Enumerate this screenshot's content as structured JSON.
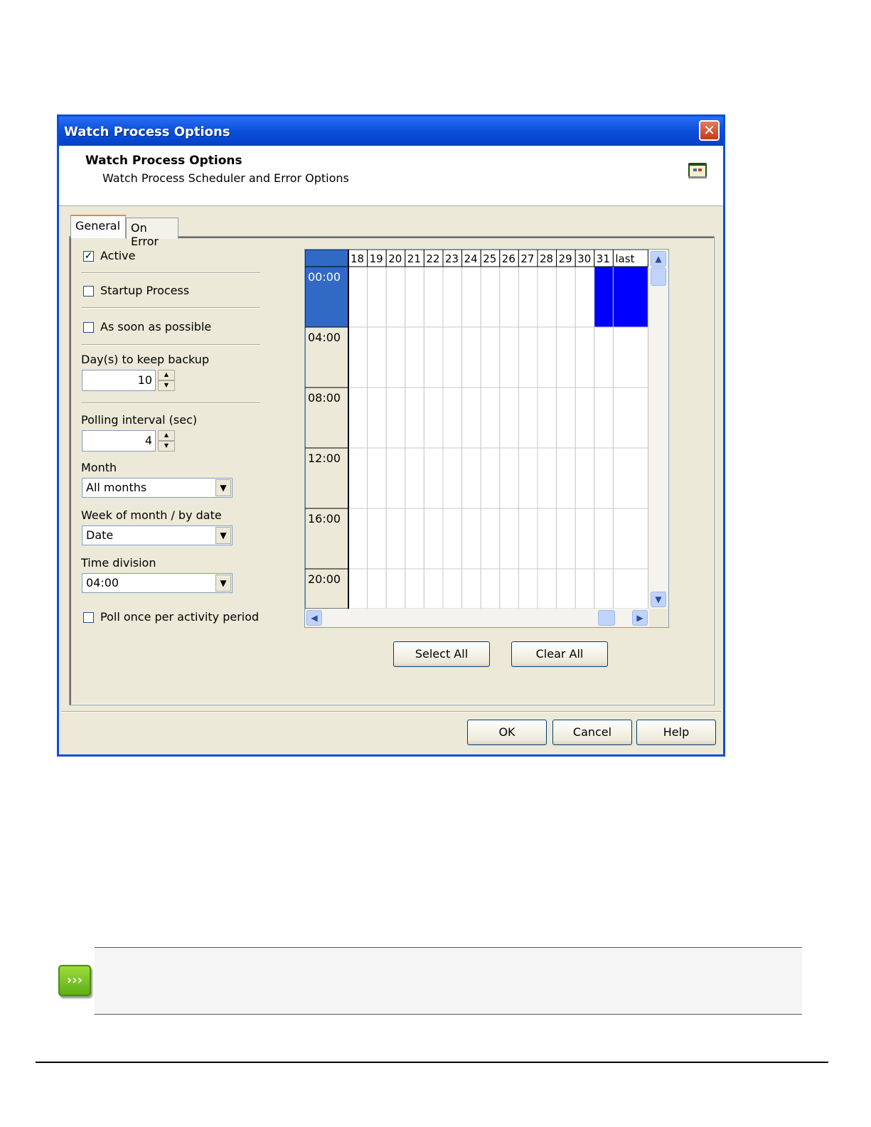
{
  "dialog": {
    "title": "Watch Process Options",
    "close_label": "✕",
    "header_title": "Watch Process Options",
    "header_subtitle": "Watch Process Scheduler and Error Options"
  },
  "tabs": [
    {
      "label": "General",
      "selected": true
    },
    {
      "label": "On Error",
      "selected": false
    }
  ],
  "general": {
    "active": {
      "label": "Active",
      "checked": true
    },
    "startup_process": {
      "label": "Startup Process",
      "checked": false
    },
    "as_soon_as_possible": {
      "label": "As soon as possible",
      "checked": false
    },
    "days_to_keep_backup": {
      "label": "Day(s) to keep backup",
      "value": "10"
    },
    "polling_interval": {
      "label": "Polling interval (sec)",
      "value": "4"
    },
    "month": {
      "label": "Month",
      "value": "All months"
    },
    "week_of_month": {
      "label": "Week of month / by date",
      "value": "Date"
    },
    "time_division": {
      "label": "Time division",
      "value": "04:00"
    },
    "poll_once": {
      "label": "Poll once per activity period",
      "checked": false
    }
  },
  "schedule": {
    "columns": [
      "18",
      "19",
      "20",
      "21",
      "22",
      "23",
      "24",
      "25",
      "26",
      "27",
      "28",
      "29",
      "30",
      "31",
      "last"
    ],
    "rows": [
      "00:00",
      "04:00",
      "08:00",
      "12:00",
      "16:00",
      "20:00"
    ],
    "selected_row_header": "00:00",
    "selected_cells": [
      {
        "row": "00:00",
        "column": "31"
      },
      {
        "row": "00:00",
        "column": "last"
      }
    ]
  },
  "buttons": {
    "select_all": "Select All",
    "clear_all": "Clear All",
    "ok": "OK",
    "cancel": "Cancel",
    "help": "Help"
  },
  "colors": {
    "selection": "#0000ff",
    "row_header_selected": "#316ac5",
    "title_bar": "#0a4fd8"
  },
  "icons": {
    "header": "calendar-icon",
    "note": "note-arrows-icon"
  }
}
